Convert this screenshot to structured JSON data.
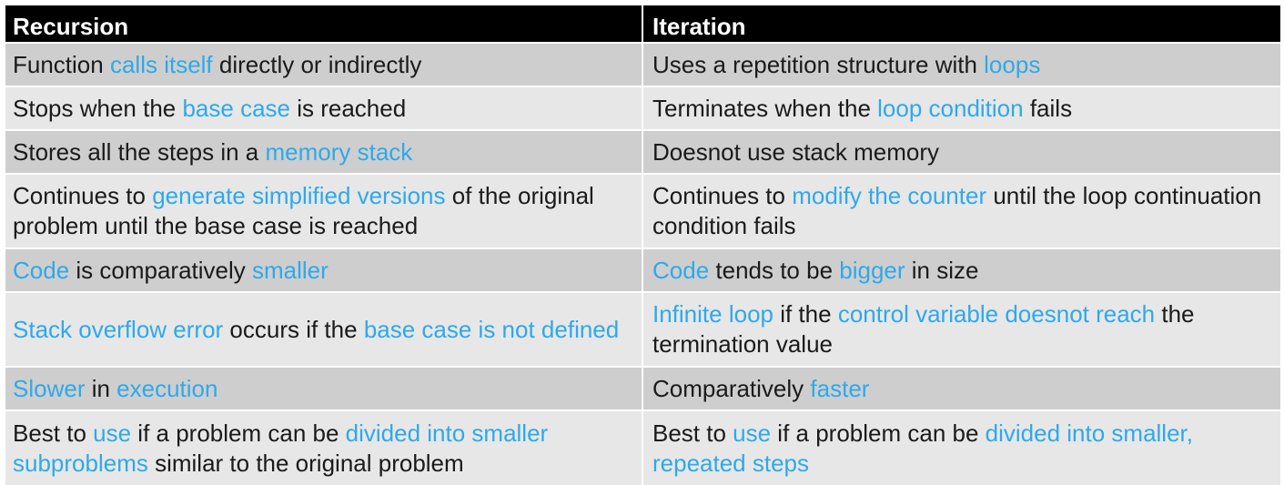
{
  "table": {
    "headers": [
      "Recursion",
      "Iteration"
    ],
    "highlight_color": "#2ea9e9",
    "rows": [
      {
        "recursion": [
          {
            "t": "Function ",
            "h": false
          },
          {
            "t": "calls itself",
            "h": true
          },
          {
            "t": " directly or indirectly",
            "h": false
          }
        ],
        "iteration": [
          {
            "t": "Uses a repetition structure with ",
            "h": false
          },
          {
            "t": "loops",
            "h": true
          }
        ]
      },
      {
        "recursion": [
          {
            "t": "Stops when the ",
            "h": false
          },
          {
            "t": "base case",
            "h": true
          },
          {
            "t": " is reached",
            "h": false
          }
        ],
        "iteration": [
          {
            "t": "Terminates when the ",
            "h": false
          },
          {
            "t": "loop condition",
            "h": true
          },
          {
            "t": " fails",
            "h": false
          }
        ]
      },
      {
        "recursion": [
          {
            "t": "Stores all the steps in a ",
            "h": false
          },
          {
            "t": "memory stack",
            "h": true
          }
        ],
        "iteration": [
          {
            "t": "Doesnot use stack memory",
            "h": false
          }
        ]
      },
      {
        "recursion": [
          {
            "t": "Continues to ",
            "h": false
          },
          {
            "t": "generate simplified versions",
            "h": true
          },
          {
            "t": " of the original problem until the base case is reached",
            "h": false
          }
        ],
        "iteration": [
          {
            "t": "Continues to ",
            "h": false
          },
          {
            "t": "modify the counter",
            "h": true
          },
          {
            "t": " until the loop continuation condition fails",
            "h": false
          }
        ]
      },
      {
        "recursion": [
          {
            "t": "Code",
            "h": true
          },
          {
            "t": " is comparatively ",
            "h": false
          },
          {
            "t": "smaller",
            "h": true
          }
        ],
        "iteration": [
          {
            "t": "Code",
            "h": true
          },
          {
            "t": " tends to be ",
            "h": false
          },
          {
            "t": "bigger",
            "h": true
          },
          {
            "t": " in size",
            "h": false
          }
        ]
      },
      {
        "recursion": [
          {
            "t": "Stack overflow error",
            "h": true
          },
          {
            "t": " occurs if the ",
            "h": false
          },
          {
            "t": "base case is not defined",
            "h": true
          }
        ],
        "iteration": [
          {
            "t": "Infinite loop",
            "h": true
          },
          {
            "t": " if the ",
            "h": false
          },
          {
            "t": "control variable doesnot reach",
            "h": true
          },
          {
            "t": " the termination value",
            "h": false
          }
        ]
      },
      {
        "recursion": [
          {
            "t": "Slower",
            "h": true
          },
          {
            "t": " in ",
            "h": false
          },
          {
            "t": "execution",
            "h": true
          }
        ],
        "iteration": [
          {
            "t": "Comparatively ",
            "h": false
          },
          {
            "t": "faster",
            "h": true
          }
        ]
      },
      {
        "recursion": [
          {
            "t": "Best to ",
            "h": false
          },
          {
            "t": "use",
            "h": true
          },
          {
            "t": " if a problem can be ",
            "h": false
          },
          {
            "t": "divided into smaller subproblems",
            "h": true
          },
          {
            "t": " similar to the original problem",
            "h": false
          }
        ],
        "iteration": [
          {
            "t": "Best to ",
            "h": false
          },
          {
            "t": "use",
            "h": true
          },
          {
            "t": " if a problem can be ",
            "h": false
          },
          {
            "t": "divided into smaller, repeated steps",
            "h": true
          }
        ]
      }
    ]
  }
}
